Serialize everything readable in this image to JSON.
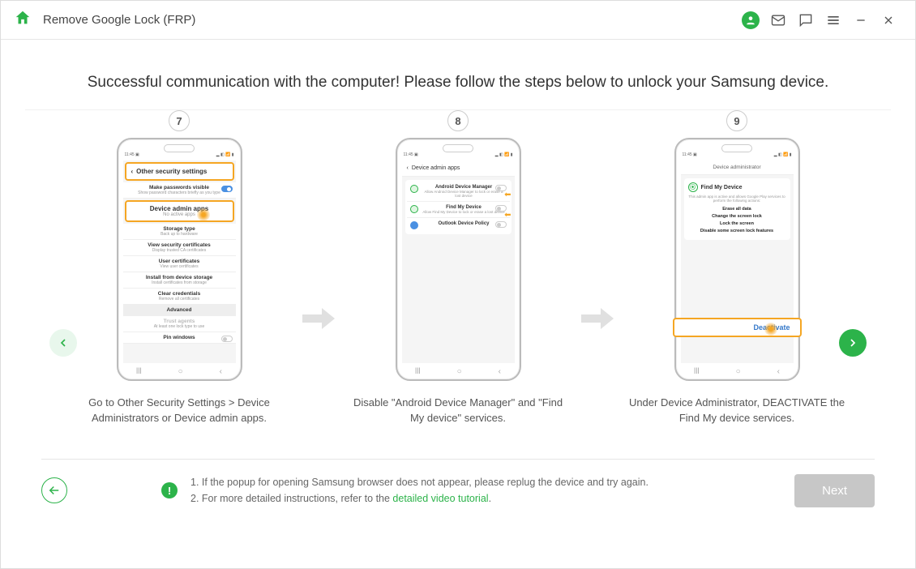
{
  "titlebar": {
    "title": "Remove Google Lock (FRP)"
  },
  "headline": "Successful communication with the computer! Please follow the steps below to unlock your Samsung device.",
  "steps": [
    {
      "num": "7",
      "caption": "Go to Other Security Settings > Device Administrators or Device admin apps.",
      "phone": {
        "header": "Other security settings",
        "highlight_title": "Device admin apps",
        "highlight_sub": "No active apps",
        "rows": [
          {
            "t": "Make passwords visible",
            "s": "Show password characters briefly as you type"
          },
          {
            "t": "Storage type",
            "s": "Back up to hardware"
          },
          {
            "t": "View security certificates",
            "s": "Display trusted CA certificates"
          },
          {
            "t": "User certificates",
            "s": "View user certificates"
          },
          {
            "t": "Install from device storage",
            "s": "Install certificates from storage"
          },
          {
            "t": "Clear credentials",
            "s": "Remove all certificates"
          },
          {
            "t": "Advanced",
            "s": ""
          },
          {
            "t": "Trust agents",
            "s": "At least one lock type to use"
          },
          {
            "t": "Pin windows",
            "s": ""
          }
        ]
      }
    },
    {
      "num": "8",
      "caption": "Disable \"Android Device Manager\" and \"Find My device\" services.",
      "phone": {
        "screen_title": "Device admin apps",
        "rows": [
          {
            "t": "Android Device Manager",
            "s": "Allow Android Device Manager to lock or erase a lost device"
          },
          {
            "t": "Find My Device",
            "s": "Allow Find My Device to lock or erase a lost device"
          },
          {
            "t": "Outlook Device Policy",
            "s": ""
          }
        ]
      }
    },
    {
      "num": "9",
      "caption": "Under Device Administrator, DEACTIVATE the Find My device services.",
      "phone": {
        "header": "Device administrator",
        "title": "Find My Device",
        "desc": "This admin app is active and allows Google Play services to perform the following actions:",
        "bullets": [
          "Erase all data",
          "Change the screen lock",
          "Lock the screen",
          "Disable some screen lock features"
        ],
        "action": "Deactivate"
      }
    }
  ],
  "footer": {
    "note1": "1. If the popup for opening Samsung browser does not appear, please replug the device and try again.",
    "note2_prefix": "2. For more detailed instructions, refer to the ",
    "note2_link": "detailed video tutorial",
    "note2_suffix": ".",
    "next": "Next"
  }
}
